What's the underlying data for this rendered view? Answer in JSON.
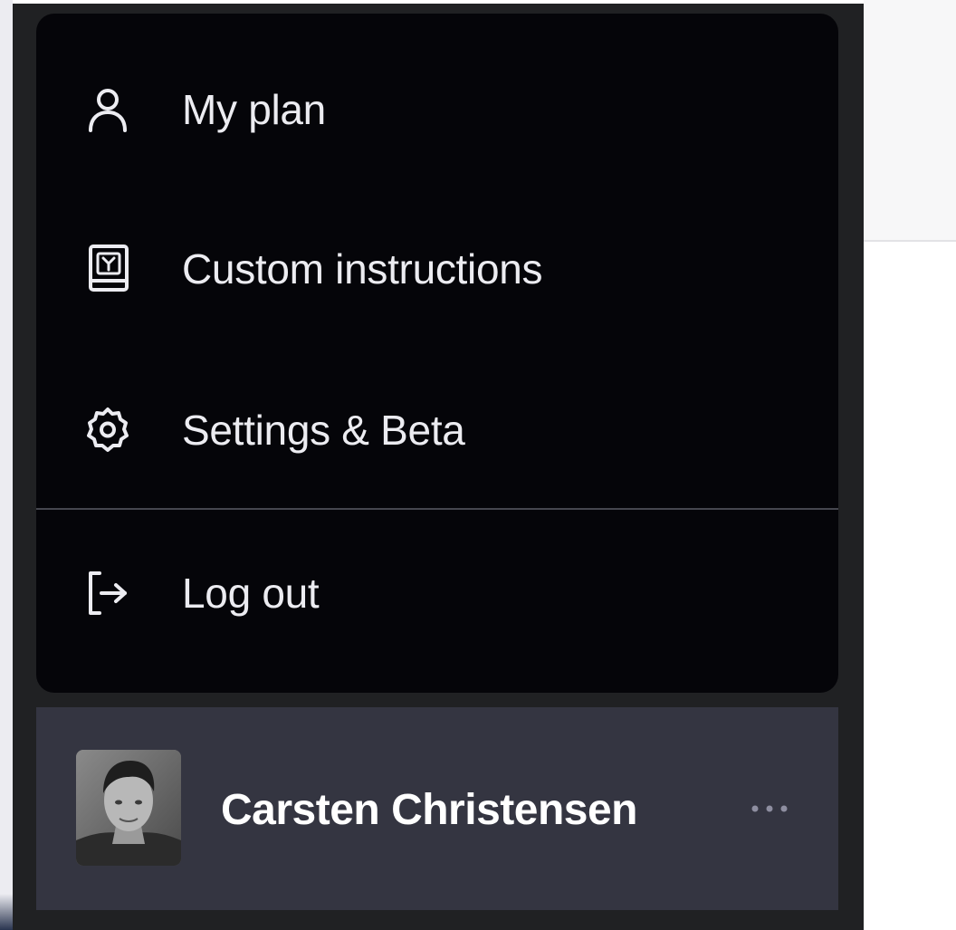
{
  "menu": {
    "items": [
      {
        "label": "My plan",
        "icon": "user-icon"
      },
      {
        "label": "Custom instructions",
        "icon": "instructions-book-icon"
      },
      {
        "label": "Settings & Beta",
        "icon": "gear-icon"
      },
      {
        "label": "Log out",
        "icon": "logout-icon"
      }
    ]
  },
  "user": {
    "name": "Carsten Christensen",
    "avatar": "avatar-photo",
    "more_icon": "ellipsis-icon"
  },
  "colors": {
    "menu_bg": "#050509",
    "sidebar_bg": "#202123",
    "user_row_bg": "#343541",
    "text": "#ececf1"
  }
}
